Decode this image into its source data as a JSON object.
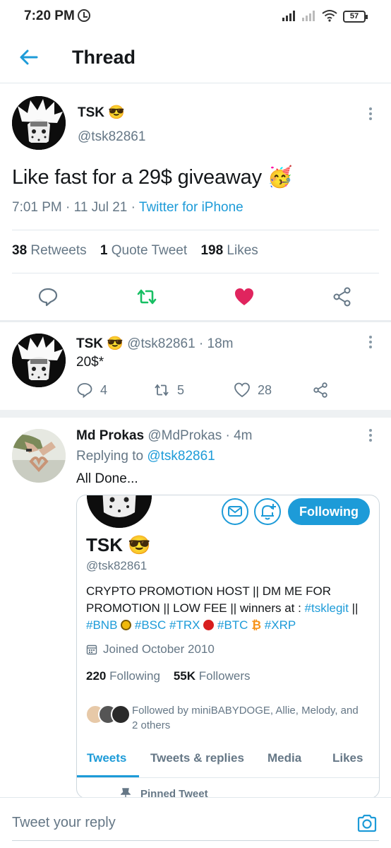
{
  "status_bar": {
    "time": "7:20 PM",
    "battery": "57"
  },
  "header": {
    "title": "Thread"
  },
  "main_tweet": {
    "name": "TSK",
    "name_emoji": "😎",
    "handle": "@tsk82861",
    "text": "Like fast for a 29$ giveaway",
    "text_emoji": "🥳",
    "time": "7:01 PM",
    "date": "11 Jul 21",
    "source": "Twitter for iPhone",
    "retweets_count": "38",
    "retweets_label": "Retweets",
    "quotes_count": "1",
    "quotes_label": "Quote Tweet",
    "likes_count": "198",
    "likes_label": "Likes",
    "accent": "#1d9bd8",
    "retweet_color": "#17bf63",
    "like_color": "#e0245e"
  },
  "reply1": {
    "name": "TSK",
    "name_emoji": "😎",
    "handle": "@tsk82861",
    "time": "18m",
    "text": "20$*",
    "replies": "4",
    "retweets": "5",
    "likes": "28"
  },
  "reply2": {
    "name": "Md Prokas",
    "handle": "@MdProkas",
    "time": "4m",
    "replying_label": "Replying to",
    "replying_to": "@tsk82861",
    "text": "All Done..."
  },
  "card": {
    "follow_button": "Following",
    "name": "TSK",
    "name_emoji": "😎",
    "handle": "@tsk82861",
    "bio_plain": "CRYPTO PROMOTION HOST || DM ME FOR PROMOTION || LOW FEE || winners at : ",
    "bio_tag1": "#tsklegit",
    "bio_sep": " ||",
    "tag_bnb": "#BNB",
    "tag_bsc": "#BSC",
    "tag_trx": "#TRX",
    "tag_btc": "#BTC",
    "tag_xrp": "#XRP",
    "btc_symbol": "₿",
    "joined": "Joined October 2010",
    "following_count": "220",
    "following_label": "Following",
    "followers_count": "55K",
    "followers_label": "Followers",
    "followed_by": "Followed by miniBABYDOGE, Allie, Melody, and 2 others",
    "tabs": [
      {
        "label": "Tweets"
      },
      {
        "label": "Tweets & replies"
      },
      {
        "label": "Media"
      },
      {
        "label": "Likes"
      }
    ],
    "pinned": "Pinned Tweet"
  },
  "reply_bar": {
    "placeholder": "Tweet your reply",
    "icons": [
      "camera-icon"
    ]
  }
}
